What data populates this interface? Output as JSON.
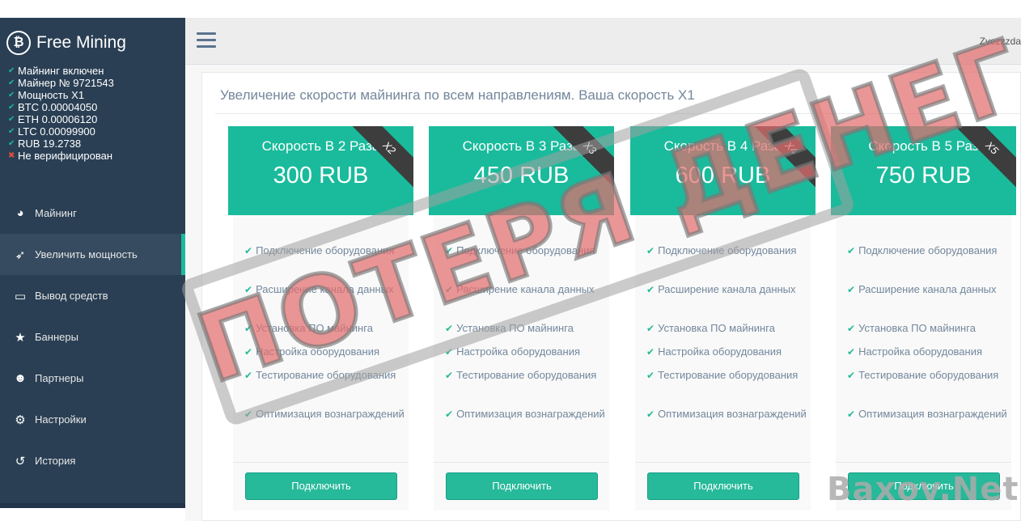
{
  "brand": {
    "logo": "₿",
    "name": "Free Mining"
  },
  "status": [
    {
      "ok": true,
      "text": "Майнинг включен"
    },
    {
      "ok": true,
      "text": "Майнер № 9721543"
    },
    {
      "ok": true,
      "text": "Мощность X1"
    },
    {
      "ok": true,
      "text": "BTC 0.00004050"
    },
    {
      "ok": true,
      "text": "ETH 0.00006120"
    },
    {
      "ok": true,
      "text": "LTC 0.00099900"
    },
    {
      "ok": true,
      "text": "RUB 19.2738"
    },
    {
      "ok": false,
      "text": "Не верифицирован"
    }
  ],
  "menu": [
    {
      "icon": "pie-chart-icon",
      "glyph": "◕",
      "label": "Майнинг"
    },
    {
      "icon": "rocket-icon",
      "glyph": "➶",
      "label": "Увеличить мощность",
      "active": true
    },
    {
      "icon": "credit-card-icon",
      "glyph": "▭",
      "label": "Вывод средств"
    },
    {
      "icon": "star-icon",
      "glyph": "★",
      "label": "Баннеры"
    },
    {
      "icon": "users-icon",
      "glyph": "☻",
      "label": "Партнеры"
    },
    {
      "icon": "gears-icon",
      "glyph": "⚙",
      "label": "Настройки"
    },
    {
      "icon": "history-icon",
      "glyph": "↺",
      "label": "История"
    }
  ],
  "topnav": {
    "user": "Zvezzzda"
  },
  "panel": {
    "title": "Увеличение скорости майнинга по всем направлениям. Ваша скорость X1"
  },
  "plans": [
    {
      "title": "Скорость В 2 Раза",
      "price": "300 RUB",
      "ribbon": "X2",
      "button": "Подключить"
    },
    {
      "title": "Скорость В 3 Раза",
      "price": "450 RUB",
      "ribbon": "X3",
      "button": "Подключить"
    },
    {
      "title": "Скорость В 4 Раза",
      "price": "600 RUB",
      "ribbon": "X4",
      "button": "Подключить"
    },
    {
      "title": "Скорость В 5 Раз",
      "price": "750 RUB",
      "ribbon": "X5",
      "button": "Подключить"
    }
  ],
  "features": [
    "Подключение оборудования",
    "Расширение канала данных",
    "Установка ПО майнинга",
    "Настройка оборудования",
    "Тестирование оборудования",
    "Оптимизация вознаграждений"
  ],
  "overlay": {
    "stamp": "ПОТЕРЯ ДЕНЕГ",
    "watermark": "Baxov.Net"
  },
  "colors": {
    "sidebar": "#2a3f54",
    "accent": "#1abb9c",
    "button": "#26b99a"
  }
}
